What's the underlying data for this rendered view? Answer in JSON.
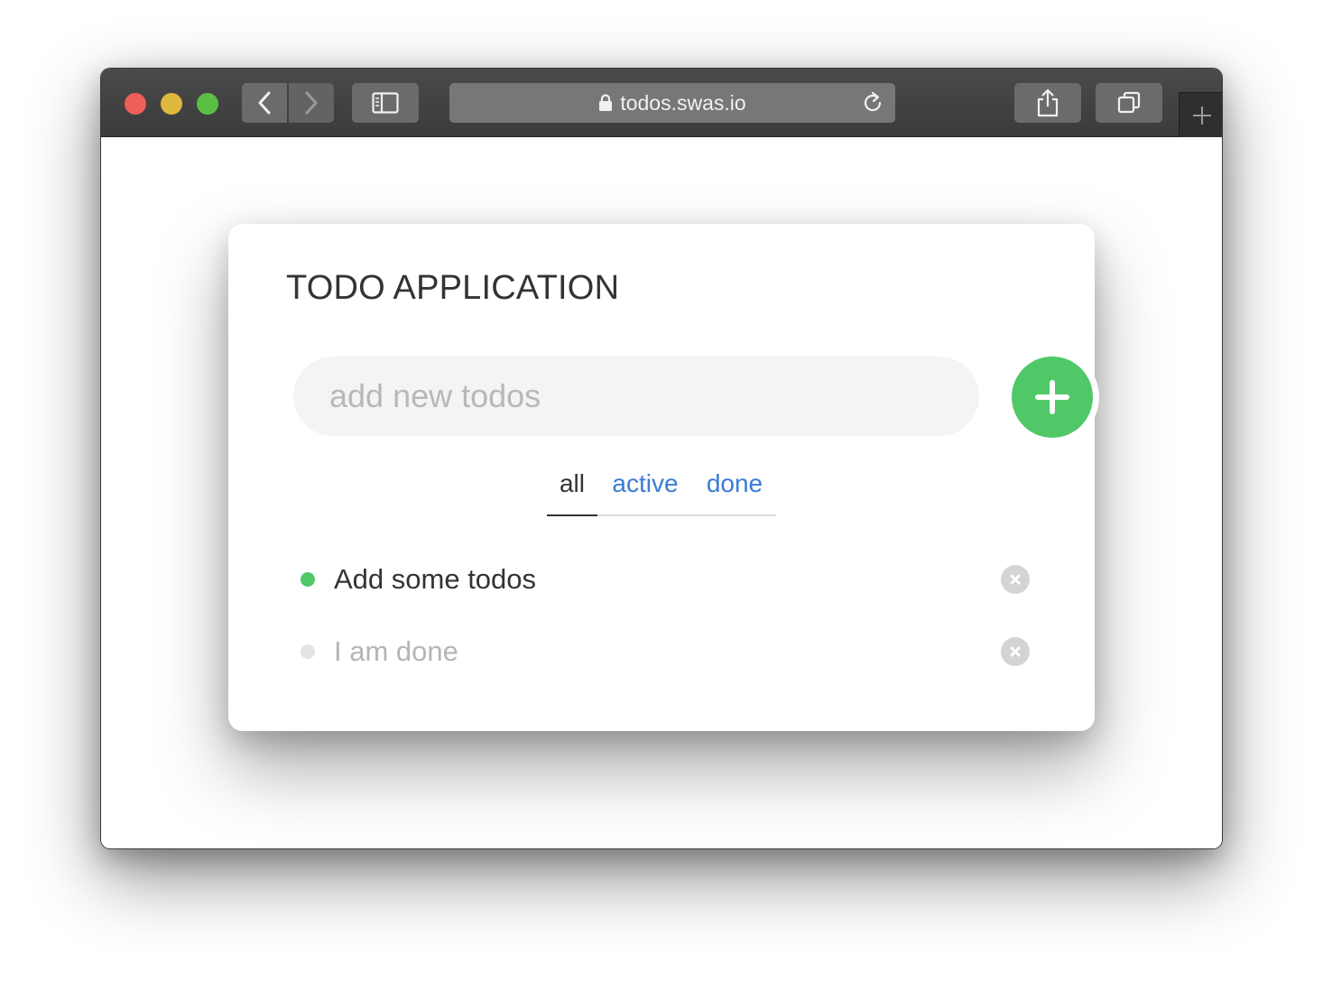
{
  "browser": {
    "url": "todos.swas.io",
    "icons": {
      "back": "chevron-left-icon",
      "forward": "chevron-right-icon",
      "sidebar": "sidebar-icon",
      "lock": "lock-icon",
      "reload": "reload-icon",
      "share": "share-icon",
      "tabs": "tabs-overview-icon",
      "new_tab": "plus-icon"
    },
    "colors": {
      "close": "#ee5f57",
      "minimize": "#dfb83e",
      "maximize": "#5cbf45",
      "toolbar": "#3f3f3f"
    }
  },
  "app": {
    "title": "TODO APPLICATION",
    "input": {
      "placeholder": "add new todos",
      "value": ""
    },
    "add_button_icon": "plus-icon",
    "accent": "#50c868",
    "link_color": "#3a7bd5",
    "filters": [
      {
        "label": "all",
        "selected": true
      },
      {
        "label": "active",
        "selected": false
      },
      {
        "label": "done",
        "selected": false
      }
    ],
    "todos": [
      {
        "text": "Add some todos",
        "done": false
      },
      {
        "text": "I am done",
        "done": true
      }
    ],
    "remove_icon": "close-icon"
  }
}
